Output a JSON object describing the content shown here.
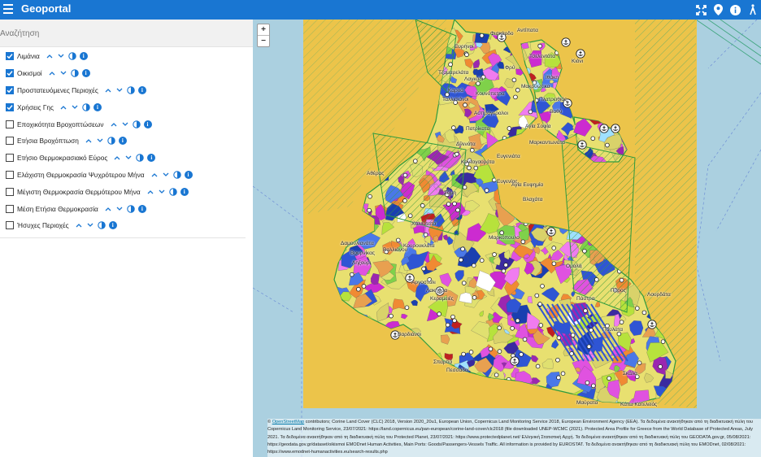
{
  "app": {
    "title": "Geoportal"
  },
  "toolbar": {
    "icons": [
      "menu-icon",
      "fullscreen-icon",
      "location-icon",
      "info-icon",
      "walk-icon"
    ]
  },
  "search": {
    "placeholder": "Αναζήτηση",
    "value": ""
  },
  "layers": [
    {
      "name": "Λιμάνια",
      "checked": true
    },
    {
      "name": "Οικισμοί",
      "checked": true
    },
    {
      "name": "Προστατευόμενες Περιοχές",
      "checked": true
    },
    {
      "name": "Χρήσεις Γης",
      "checked": true
    },
    {
      "name": "Εποχικότητα Βροχοπτώσεων",
      "checked": false
    },
    {
      "name": "Ετήσια Βροχόπτωση",
      "checked": false
    },
    {
      "name": "Ετήσιο Θερμοκρασιακό Εύρος",
      "checked": false
    },
    {
      "name": "Ελάχιστη Θερμοκρασία Ψυχρότερου Μήνα",
      "checked": false
    },
    {
      "name": "Μέγιστη Θερμοκρασία Θερμότερου Μήνα",
      "checked": false
    },
    {
      "name": "Μέση Ετήσια Θερμοκρασία",
      "checked": false
    },
    {
      "name": "Ήσυχες Περιοχές",
      "checked": false
    }
  ],
  "map": {
    "zoom_in": "+",
    "zoom_out": "−",
    "labels": [
      "Φισκάρδο",
      "Αντίπατα",
      "Ευρηνοί",
      "Τσελεντάτα",
      "Φρύ",
      "Τζαμαρελάτα",
      "Λαγκάδι",
      "Καρυά",
      "Ταλλισιάνοι",
      "Κουνόπετρα",
      "Μακρυώτικα",
      "Ασπρόγεραλοι",
      "Πατρίκατα",
      "Αγία Σοφία",
      "Μαρκαντωνάτα",
      "Ιθάκη",
      "Βαθύ",
      "Πλατρειθιάς",
      "Κιόνι",
      "Ευγενίας",
      "Αγία Ευφημία",
      "Αθέρας",
      "Σάμη",
      "Χαλιώτατα",
      "Δαμουλιανάτα",
      "Ληξούρι",
      "Βουρνίκας",
      "Βαλλιάνου",
      "Κουρουκλάτα",
      "Αργοστόλι",
      "Λακήθρα",
      "Κεραμειές",
      "Βαρδιάνοι",
      "Σπαρτιά",
      "Πεσσάδα",
      "Μαύρατα",
      "Κάτω Κατελειός",
      "Σκάλα",
      "Πόρος",
      "Λουρδάτα",
      "Πουλάτα",
      "Πάστρα",
      "Ομαλά",
      "Μαρκόπουλο",
      "Βλαχάτα",
      "Κοντογουράτα",
      "Δίλινάτα",
      "Ευγενιάτα"
    ],
    "attribution": {
      "osm_link": "OpenStreetMap",
      "text": " contributors; Corine Land Cover (CLC) 2018, Version 2020_20u1, European Union, Copernicus Land Monitoring Service 2018, European Environment Agency (EEA). Τα δεδομένα ανακτήθηκαν από τη διαδικτυακή πύλη του Copernicus Land Monitoring Service, 23/07/2021: https://land.copernicus.eu/pan-european/corine-land-cover/clc2018 (file downloaded UNEP-WCMC (2021). Protected Area Profile for Greece from the World Database of Protected Areas, July 2021. Τα δεδομένα ανακτήθηκαν από τη διαδικτυακή πύλη του Protected Planet, 23/07/2021: https://www.protectedplanet.net/ Ελληνική Στατιστική Αρχή. Τα δεδομένα ανακτήθηκαν από τη διαδικτυακή πύλη του GEODATA.gov.gr, 05/08/2021: https://geodata.gov.gr/dataset/oikismoi EMODnet Human Activities, Main Ports: Goods/Passengers-Vessels Traffic. All information is provided by EUROSTAT. Τα δεδομένα ανακτήθηκαν από τη διαδικτυακή πύλη του EMODnet, 02/08/2021: https://www.emodnet-humanactivities.eu/search-results.php"
    }
  }
}
